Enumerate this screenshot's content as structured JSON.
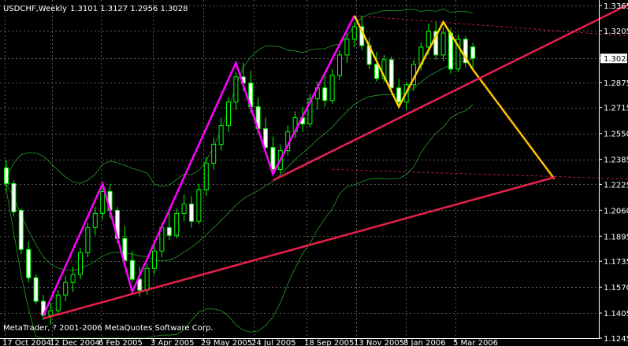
{
  "window": {
    "symbol": "USDCHF,Weekly",
    "ohlc": "1.3101 1.3127 1.2956 1.3028",
    "footer": "MetaTrader, ? 2001-2006 MetaQuotes Software Corp."
  },
  "colors": {
    "background": "#000000",
    "grid": "#5a5a5a",
    "candle": "#00ff00",
    "band": "#2fbf2f",
    "wave1": "#ff00ff",
    "wave2": "#ffd200",
    "trendline": "#e8204c",
    "projection": "#ffc000",
    "price_box": "#ffffff"
  },
  "chart_data": {
    "type": "candlestick",
    "title": "USDCHF,Weekly",
    "ylim": [
      1.1245,
      1.3365
    ],
    "grid": true,
    "y_ticks": [
      "1.3365",
      "1.3205",
      "1.3028",
      "1.2875",
      "1.2715",
      "1.2550",
      "1.2385",
      "1.2225",
      "1.2060",
      "1.1895",
      "1.1735",
      "1.1570",
      "1.1405",
      "1.1245"
    ],
    "x_ticks": [
      "17 Oct 2004",
      "12 Dec 2004",
      "6 Feb 2005",
      "3 Apr 2005",
      "29 May 2005",
      "24 Jul 2005",
      "18 Sep 2005",
      "13 Nov 2005",
      "8 Jan 2006",
      "5 Mar 2006"
    ],
    "current_price": 1.3028,
    "last_ohlc": {
      "open": 1.3101,
      "high": 1.3127,
      "low": 1.2956,
      "close": 1.3028
    },
    "candles": [
      [
        1.233,
        1.238,
        1.218,
        1.223
      ],
      [
        1.223,
        1.225,
        1.202,
        1.205
      ],
      [
        1.206,
        1.207,
        1.178,
        1.181
      ],
      [
        1.181,
        1.186,
        1.16,
        1.163
      ],
      [
        1.163,
        1.165,
        1.146,
        1.148
      ],
      [
        1.148,
        1.152,
        1.136,
        1.139
      ],
      [
        1.139,
        1.147,
        1.133,
        1.142
      ],
      [
        1.142,
        1.155,
        1.14,
        1.152
      ],
      [
        1.152,
        1.164,
        1.148,
        1.16
      ],
      [
        1.16,
        1.17,
        1.154,
        1.165
      ],
      [
        1.165,
        1.182,
        1.162,
        1.179
      ],
      [
        1.179,
        1.198,
        1.176,
        1.195
      ],
      [
        1.195,
        1.208,
        1.19,
        1.204
      ],
      [
        1.204,
        1.221,
        1.2,
        1.218
      ],
      [
        1.218,
        1.223,
        1.201,
        1.206
      ],
      [
        1.206,
        1.208,
        1.185,
        1.188
      ],
      [
        1.188,
        1.196,
        1.17,
        1.174
      ],
      [
        1.174,
        1.18,
        1.16,
        1.162
      ],
      [
        1.162,
        1.17,
        1.151,
        1.155
      ],
      [
        1.155,
        1.172,
        1.152,
        1.169
      ],
      [
        1.169,
        1.184,
        1.165,
        1.18
      ],
      [
        1.18,
        1.198,
        1.176,
        1.195
      ],
      [
        1.195,
        1.208,
        1.187,
        1.19
      ],
      [
        1.19,
        1.207,
        1.188,
        1.204
      ],
      [
        1.204,
        1.216,
        1.199,
        1.21
      ],
      [
        1.21,
        1.215,
        1.195,
        1.199
      ],
      [
        1.199,
        1.223,
        1.197,
        1.219
      ],
      [
        1.219,
        1.24,
        1.215,
        1.236
      ],
      [
        1.236,
        1.252,
        1.232,
        1.248
      ],
      [
        1.248,
        1.265,
        1.244,
        1.26
      ],
      [
        1.26,
        1.278,
        1.256,
        1.275
      ],
      [
        1.275,
        1.294,
        1.27,
        1.291
      ],
      [
        1.291,
        1.3,
        1.282,
        1.287
      ],
      [
        1.287,
        1.295,
        1.268,
        1.272
      ],
      [
        1.272,
        1.278,
        1.255,
        1.258
      ],
      [
        1.258,
        1.265,
        1.242,
        1.246
      ],
      [
        1.246,
        1.253,
        1.228,
        1.232
      ],
      [
        1.232,
        1.248,
        1.229,
        1.244
      ],
      [
        1.244,
        1.26,
        1.241,
        1.256
      ],
      [
        1.256,
        1.269,
        1.252,
        1.265
      ],
      [
        1.265,
        1.272,
        1.256,
        1.261
      ],
      [
        1.261,
        1.28,
        1.259,
        1.277
      ],
      [
        1.277,
        1.288,
        1.27,
        1.284
      ],
      [
        1.284,
        1.292,
        1.272,
        1.276
      ],
      [
        1.276,
        1.296,
        1.274,
        1.292
      ],
      [
        1.292,
        1.308,
        1.289,
        1.305
      ],
      [
        1.305,
        1.319,
        1.3,
        1.315
      ],
      [
        1.315,
        1.326,
        1.31,
        1.323
      ],
      [
        1.323,
        1.33,
        1.308,
        1.311
      ],
      [
        1.311,
        1.316,
        1.296,
        1.299
      ],
      [
        1.299,
        1.307,
        1.288,
        1.29
      ],
      [
        1.29,
        1.305,
        1.288,
        1.302
      ],
      [
        1.302,
        1.304,
        1.281,
        1.284
      ],
      [
        1.284,
        1.29,
        1.272,
        1.275
      ],
      [
        1.275,
        1.288,
        1.27,
        1.286
      ],
      [
        1.286,
        1.302,
        1.282,
        1.299
      ],
      [
        1.299,
        1.313,
        1.295,
        1.31
      ],
      [
        1.31,
        1.325,
        1.305,
        1.32
      ],
      [
        1.32,
        1.326,
        1.302,
        1.305
      ],
      [
        1.305,
        1.323,
        1.301,
        1.319
      ],
      [
        1.319,
        1.322,
        1.293,
        1.296
      ],
      [
        1.296,
        1.318,
        1.294,
        1.315
      ],
      [
        1.315,
        1.317,
        1.297,
        1.3
      ],
      [
        1.3101,
        1.3127,
        1.2956,
        1.3028
      ]
    ]
  }
}
